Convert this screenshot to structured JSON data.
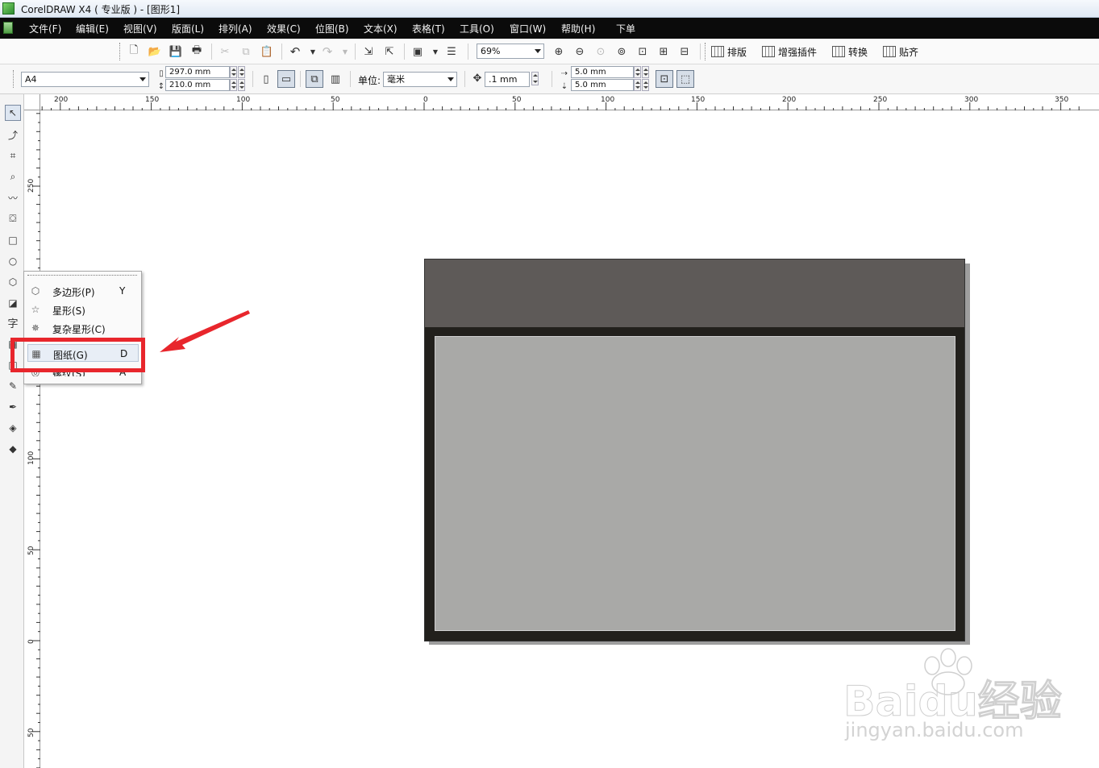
{
  "window": {
    "title": "CorelDRAW X4 ( 专业版 ) - [图形1]"
  },
  "menu": [
    "文件(F)",
    "编辑(E)",
    "视图(V)",
    "版面(L)",
    "排列(A)",
    "效果(C)",
    "位图(B)",
    "文本(X)",
    "表格(T)",
    "工具(O)",
    "窗口(W)",
    "帮助(H)",
    "下单"
  ],
  "standard_toolbar": {
    "zoom": "69%",
    "plugin_buttons": [
      "排版",
      "增强插件",
      "转换",
      "贴齐"
    ]
  },
  "property_bar": {
    "paper_size": "A4",
    "width": "297.0 mm",
    "height": "210.0 mm",
    "unit_label": "单位:",
    "unit": "毫米",
    "nudge": ".1 mm",
    "dup_x": "5.0 mm",
    "dup_y": "5.0 mm"
  },
  "ruler": {
    "top_labels": [
      "200",
      "150",
      "100",
      "50",
      "0",
      "50",
      "100",
      "150",
      "200",
      "250",
      "300",
      "350"
    ],
    "left_labels": [
      "250",
      "100",
      "50",
      "0",
      "50"
    ]
  },
  "toolbox": {
    "tools": [
      "pick-tool",
      "shape-tool",
      "crop-tool",
      "zoom-tool",
      "freehand-tool",
      "smart-fill-tool",
      "rectangle-tool",
      "ellipse-tool",
      "polygon-tool",
      "basic-shapes-tool",
      "text-tool",
      "table-tool",
      "interactive-tool",
      "eyedropper-tool",
      "outline-tool",
      "fill-tool",
      "interactive-fill-tool"
    ],
    "text_tool_glyph": "字"
  },
  "flyout_menu": {
    "items": [
      {
        "label": "多边形(P)",
        "shortcut": "Y",
        "icon": "polygon-icon"
      },
      {
        "label": "星形(S)",
        "shortcut": "",
        "icon": "star-icon"
      },
      {
        "label": "复杂星形(C)",
        "shortcut": "",
        "icon": "complex-star-icon"
      },
      {
        "label": "图纸(G)",
        "shortcut": "D",
        "icon": "graph-paper-icon"
      },
      {
        "label": "螺纹(S)",
        "shortcut": "A",
        "icon": "spiral-icon"
      }
    ]
  },
  "watermark": {
    "brand": "Baidu经验",
    "url": "jingyan.baidu.com"
  },
  "colors": {
    "menubar_bg": "#0b0b0b",
    "page_top": "#5e5a58",
    "page_frame": "#22201c",
    "page_inner": "#a9a9a7",
    "annotation": "#e8262c"
  }
}
